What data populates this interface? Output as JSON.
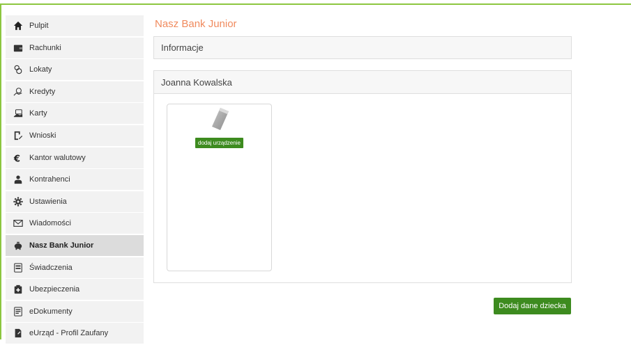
{
  "sidebar": {
    "items": [
      {
        "label": "Pulpit",
        "icon": "home-icon"
      },
      {
        "label": "Rachunki",
        "icon": "wallet-icon"
      },
      {
        "label": "Lokaty",
        "icon": "coins-icon"
      },
      {
        "label": "Kredyty",
        "icon": "hand-money-icon"
      },
      {
        "label": "Karty",
        "icon": "card-hand-icon"
      },
      {
        "label": "Wnioski",
        "icon": "form-icon"
      },
      {
        "label": "Kantor walutowy",
        "icon": "euro-icon"
      },
      {
        "label": "Kontrahenci",
        "icon": "contacts-icon"
      },
      {
        "label": "Ustawienia",
        "icon": "gear-icon"
      },
      {
        "label": "Wiadomości",
        "icon": "envelope-icon"
      },
      {
        "label": "Nasz Bank Junior",
        "icon": "piggy-bank-icon",
        "active": true
      },
      {
        "label": "Świadczenia",
        "icon": "benefits-icon"
      },
      {
        "label": "Ubezpieczenia",
        "icon": "insurance-icon"
      },
      {
        "label": "eDokumenty",
        "icon": "documents-icon"
      },
      {
        "label": "eUrząd - Profil Zaufany",
        "icon": "profile-icon"
      }
    ]
  },
  "main": {
    "title": "Nasz Bank Junior",
    "info_panel": "Informacje",
    "child_panel": {
      "name": "Joanna Kowalska",
      "add_device_label": "dodaj urządzenie"
    },
    "add_child_label": "Dodaj dane dziecka"
  },
  "colors": {
    "accent_green": "#3d8b1f",
    "frame_green": "#8cc63f",
    "title_orange": "#f08a5d"
  }
}
